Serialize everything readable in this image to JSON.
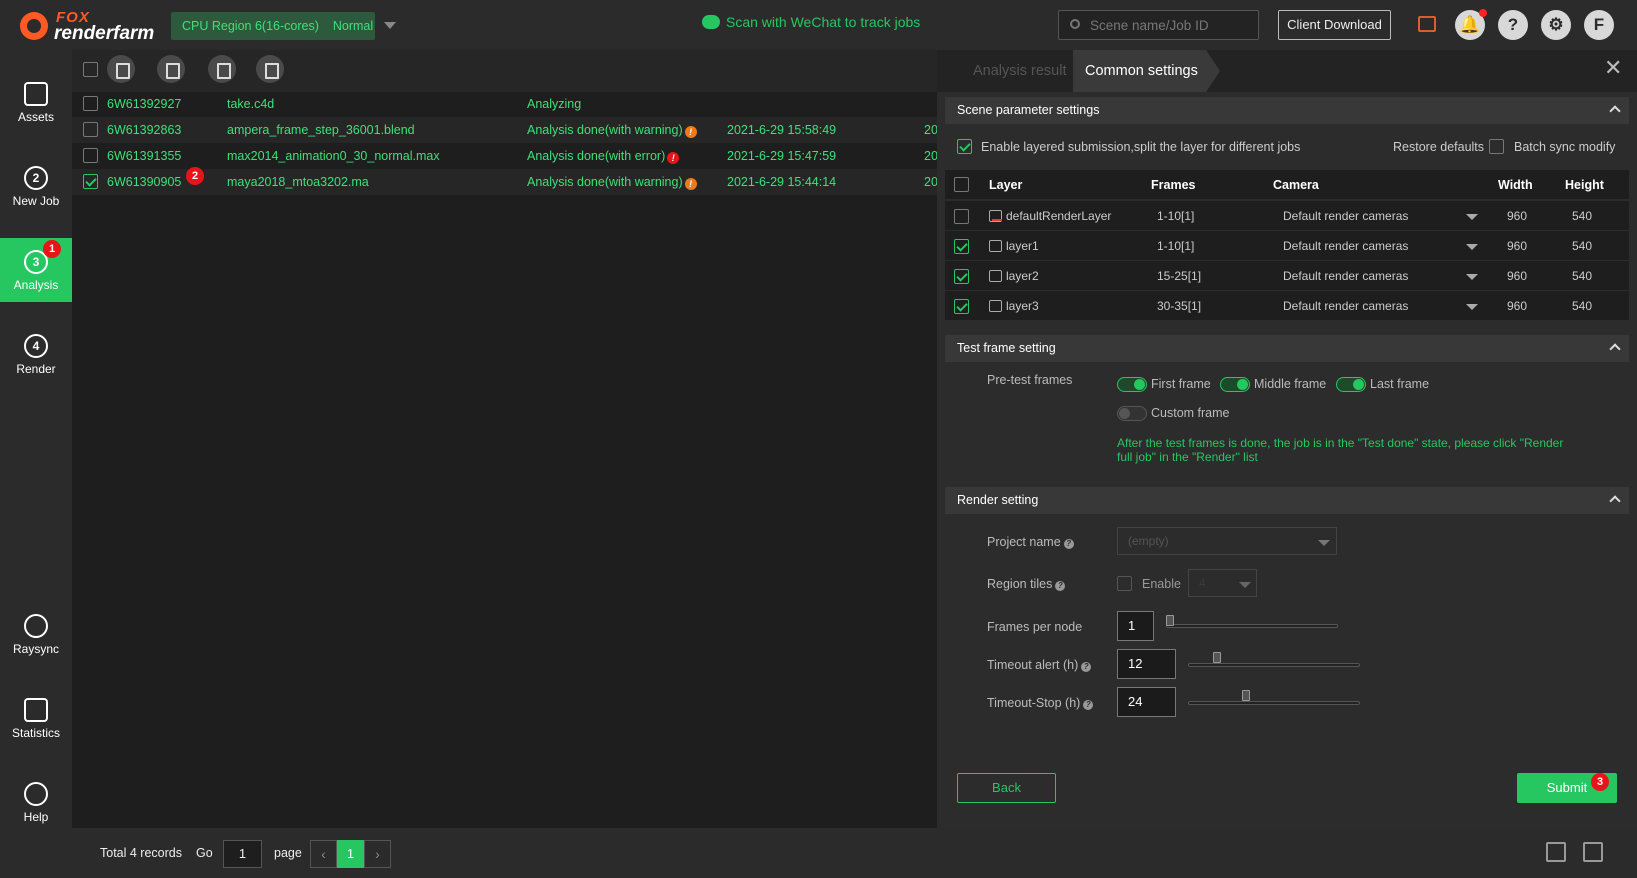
{
  "header": {
    "logo_top": "FOX",
    "logo_bottom": "renderfarm",
    "region_label": "CPU Region 6(16-cores)",
    "region_mode": "Normal",
    "wechat_text": "Scan with WeChat to track jobs",
    "search_placeholder": "Scene name/Job ID",
    "client_download": "Client Download",
    "help_symbol": "?",
    "settings_symbol": "⚙",
    "avatar_letter": "F"
  },
  "sidebar": {
    "items": [
      {
        "label": "Assets"
      },
      {
        "label": "New Job",
        "num": "2"
      },
      {
        "label": "Analysis",
        "num": "3",
        "badge": "1"
      },
      {
        "label": "Render",
        "num": "4"
      },
      {
        "label": "Raysync"
      },
      {
        "label": "Statistics"
      },
      {
        "label": "Help"
      }
    ]
  },
  "jobs": {
    "rows": [
      {
        "id": "6W61392927",
        "scene": "take.c4d",
        "status": "Analyzing",
        "time": "",
        "extra": ""
      },
      {
        "id": "6W61392863",
        "scene": "ampera_frame_step_36001.blend",
        "status": "Analysis done(with warning)",
        "icon": "!",
        "time": "2021-6-29 15:58:49",
        "extra": "20"
      },
      {
        "id": "6W61391355",
        "scene": "max2014_animation0_30_normal.max",
        "status": "Analysis done(with error)",
        "icon": "!",
        "time": "2021-6-29 15:47:59",
        "extra": "20"
      },
      {
        "id": "6W61390905",
        "scene": "maya2018_mtoa3202.ma",
        "status": "Analysis done(with warning)",
        "icon": "!",
        "time": "2021-6-29 15:44:14",
        "extra": "20",
        "badge": "2"
      }
    ]
  },
  "footer": {
    "total": "Total 4 records",
    "go": "Go",
    "page_value": "1",
    "page_label": "page",
    "prev": "‹",
    "next": "›",
    "current": "1"
  },
  "panel": {
    "tab_analysis": "Analysis result",
    "tab_common": "Common settings",
    "close": "✕",
    "scene_section": "Scene parameter settings",
    "enable_layered": "Enable layered submission,split the layer for different jobs",
    "restore_defaults": "Restore defaults",
    "batch_sync": "Batch sync modify",
    "layer_headers": {
      "layer": "Layer",
      "frames": "Frames",
      "camera": "Camera",
      "width": "Width",
      "height": "Height"
    },
    "layers": [
      {
        "name": "defaultRenderLayer",
        "frames": "1-10[1]",
        "camera": "Default render cameras",
        "width": "960",
        "height": "540",
        "checked": false
      },
      {
        "name": "layer1",
        "frames": "1-10[1]",
        "camera": "Default render cameras",
        "width": "960",
        "height": "540",
        "checked": true
      },
      {
        "name": "layer2",
        "frames": "15-25[1]",
        "camera": "Default render cameras",
        "width": "960",
        "height": "540",
        "checked": true
      },
      {
        "name": "layer3",
        "frames": "30-35[1]",
        "camera": "Default render cameras",
        "width": "960",
        "height": "540",
        "checked": true
      }
    ],
    "test_section": "Test frame setting",
    "pretest_label": "Pre-test frames",
    "first_frame": "First frame",
    "middle_frame": "Middle frame",
    "last_frame": "Last frame",
    "custom_frame": "Custom frame",
    "test_note": "After the test frames is done, the job is in the \"Test done\" state, please click \"Render full job\" in the \"Render\" list",
    "render_section": "Render setting",
    "project_name_label": "Project name",
    "project_name_value": "(empty)",
    "region_tiles_label": "Region tiles",
    "enable_label": "Enable",
    "region_tiles_value": "4",
    "frames_per_node_label": "Frames per node",
    "frames_per_node": "1",
    "timeout_alert_label": "Timeout alert (h)",
    "timeout_alert": "12",
    "timeout_stop_label": "Timeout-Stop (h)",
    "timeout_stop": "24",
    "back": "Back",
    "submit": "Submit",
    "submit_badge": "3",
    "info_mark": "?"
  },
  "colors": {
    "accent": "#26c761",
    "brand": "#fe5a24",
    "badge": "#e8141a",
    "warning": "#f07a1a"
  }
}
